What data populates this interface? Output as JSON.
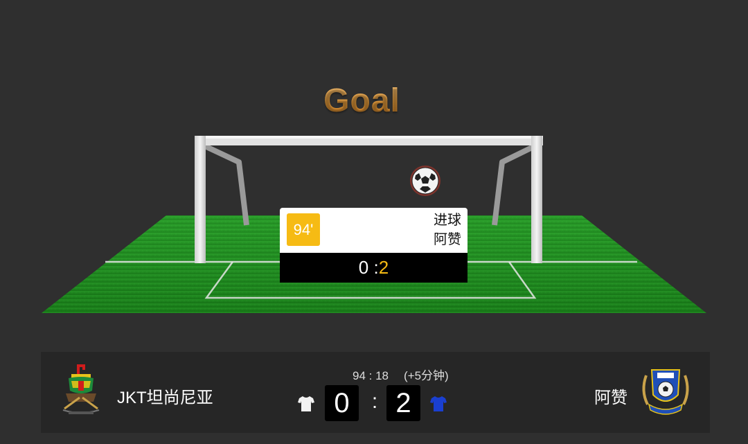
{
  "animation": {
    "title": "Goal"
  },
  "event": {
    "minute": "94'",
    "type": "进球",
    "team": "阿赞",
    "score_home": "0",
    "score_sep": ":",
    "score_away": "2"
  },
  "match": {
    "clock": "94 : 18",
    "added_time": "(+5分钟)",
    "home_team": "JKT坦尚尼亚",
    "away_team": "阿赞",
    "home_score": "0",
    "separator": ":",
    "away_score": "2",
    "home_shirt_color": "#ffffff",
    "away_shirt_color": "#1a3fd0"
  },
  "icons": {
    "home_crest": "jkt-tanzania-crest-icon",
    "away_crest": "azam-fc-crest-icon",
    "ball": "soccer-ball-icon",
    "home_shirt": "white-shirt-icon",
    "away_shirt": "blue-shirt-icon"
  },
  "colors": {
    "background": "#2f2f2f",
    "pitch": "#1e8a1e",
    "accent_yellow": "#f6bb14",
    "goal_title": "#e8a64a"
  }
}
